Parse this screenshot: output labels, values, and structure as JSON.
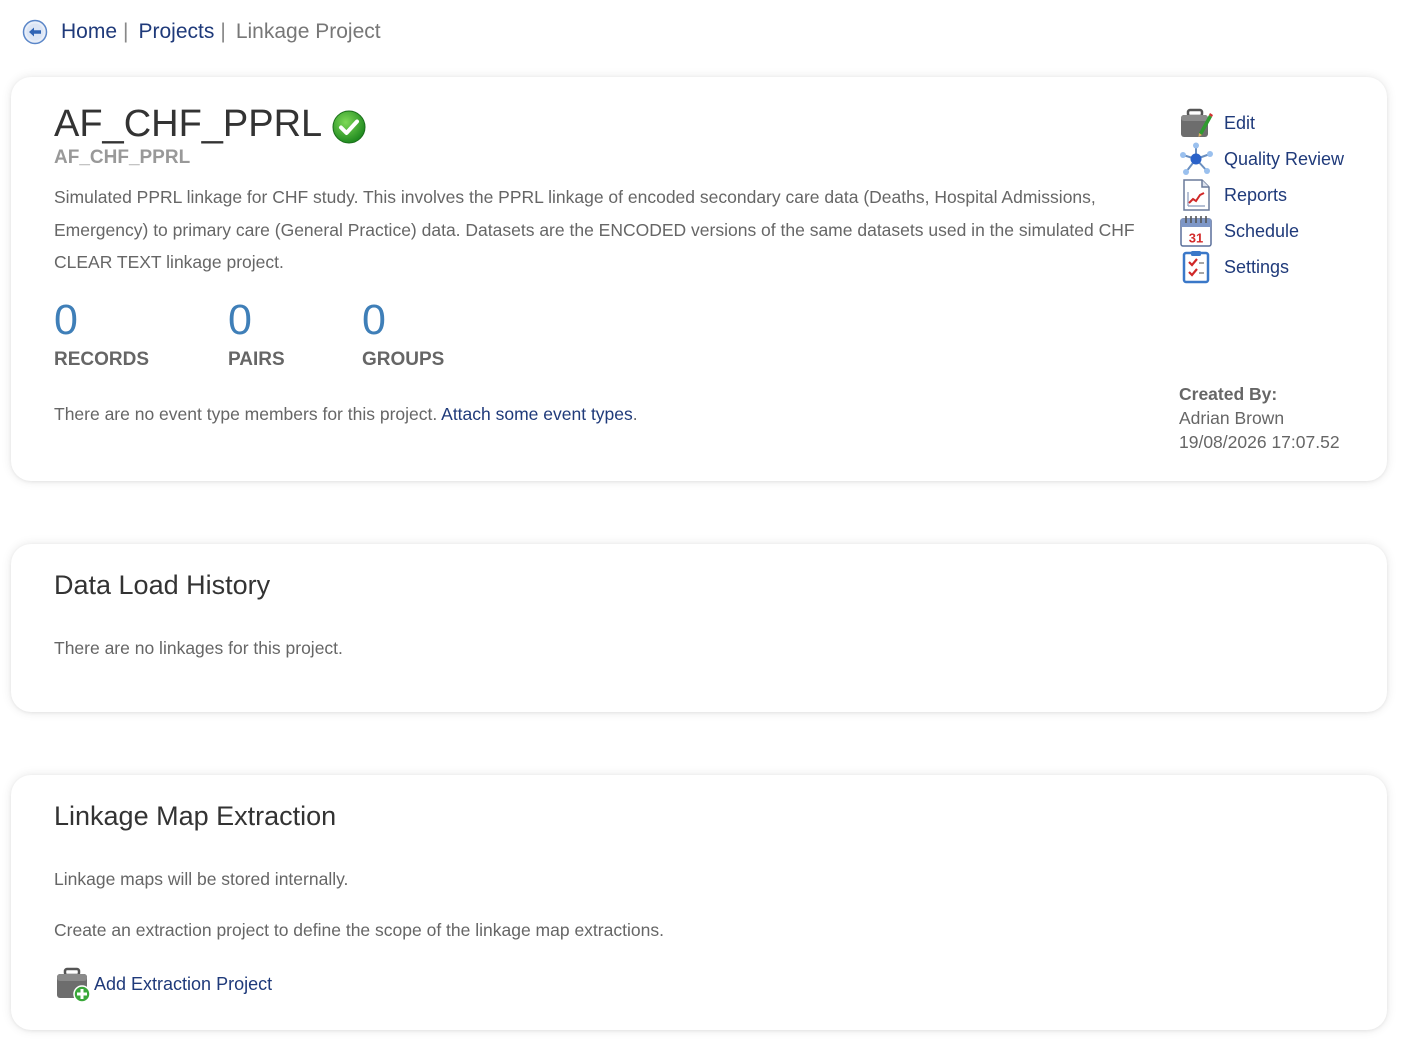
{
  "breadcrumb": {
    "home": "Home",
    "projects": "Projects",
    "current": "Linkage Project",
    "separator": "|"
  },
  "project": {
    "title": "AF_CHF_PPRL",
    "code": "AF_CHF_PPRL",
    "status_icon": "check-circle-icon",
    "description": "Simulated PPRL linkage for CHF study. This involves the PPRL linkage of encoded secondary care data (Deaths, Hospital Admissions, Emergency) to primary care (General Practice) data. Datasets are the ENCODED versions of the same datasets used in the simulated CHF CLEAR TEXT linkage project.",
    "stats": {
      "records": {
        "value": "0",
        "label": "RECORDS"
      },
      "pairs": {
        "value": "0",
        "label": "PAIRS"
      },
      "groups": {
        "value": "0",
        "label": "GROUPS"
      }
    },
    "event_msg": "There are no event type members for this project. ",
    "event_link": "Attach some event types",
    "event_period": "."
  },
  "actions": {
    "edit": "Edit",
    "quality_review": "Quality Review",
    "reports": "Reports",
    "schedule": "Schedule",
    "settings": "Settings"
  },
  "created": {
    "label": "Created By:",
    "name": "Adrian Brown",
    "timestamp": "19/08/2026 17:07.52"
  },
  "data_load_history": {
    "title": "Data Load History",
    "message": "There are no linkages for this project."
  },
  "linkage_map_extraction": {
    "title": "Linkage Map Extraction",
    "storage_msg": "Linkage maps will be stored internally.",
    "create_msg": "Create an extraction project to define the scope of the linkage map extractions.",
    "add_button": "Add Extraction Project"
  },
  "colors": {
    "link": "#1f3a7a",
    "stat_value": "#3f7fb8",
    "success": "#2e9e2e"
  }
}
